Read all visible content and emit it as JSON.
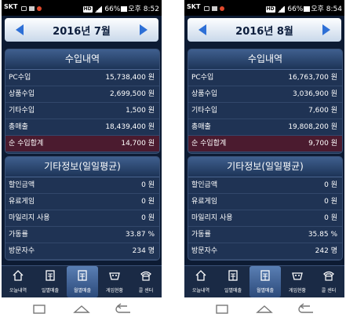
{
  "status_bar": {
    "carrier": "SKT",
    "hd_badge": "HD",
    "battery": "66%"
  },
  "phones": [
    {
      "time": "오후 8:52",
      "month_label": "2016년 7월",
      "income": {
        "title": "수입내역",
        "rows": [
          {
            "label": "PC수입",
            "value": "15,738,400 원"
          },
          {
            "label": "상품수입",
            "value": "2,699,500 원"
          },
          {
            "label": "기타수입",
            "value": "1,500 원"
          },
          {
            "label": "총매출",
            "value": "18,439,400 원"
          },
          {
            "label": "순 수입합계",
            "value": "14,700 원"
          }
        ]
      },
      "other": {
        "title": "기타정보(일일평균)",
        "rows": [
          {
            "label": "할인금액",
            "value": "0 원"
          },
          {
            "label": "유료게임",
            "value": "0 원"
          },
          {
            "label": "마일리지 사용",
            "value": "0 원"
          },
          {
            "label": "가동률",
            "value": "33.87 %"
          },
          {
            "label": "방문자수",
            "value": "234 명"
          }
        ]
      }
    },
    {
      "time": "오후 8:54",
      "month_label": "2016년 8월",
      "income": {
        "title": "수입내역",
        "rows": [
          {
            "label": "PC수입",
            "value": "16,763,700 원"
          },
          {
            "label": "상품수입",
            "value": "3,036,900 원"
          },
          {
            "label": "기타수입",
            "value": "7,600 원"
          },
          {
            "label": "총매출",
            "value": "19,808,200 원"
          },
          {
            "label": "순 수입합계",
            "value": "9,700 원"
          }
        ]
      },
      "other": {
        "title": "기타정보(일일평균)",
        "rows": [
          {
            "label": "할인금액",
            "value": "0 원"
          },
          {
            "label": "유료게임",
            "value": "0 원"
          },
          {
            "label": "마일리지 사용",
            "value": "0 원"
          },
          {
            "label": "가동률",
            "value": "35.85 %"
          },
          {
            "label": "방문자수",
            "value": "242 명"
          }
        ]
      }
    }
  ],
  "bottom_nav": [
    {
      "label": "오늘내역",
      "icon": "home-icon"
    },
    {
      "label": "일별매출",
      "icon": "daily-sales-icon"
    },
    {
      "label": "월별매출",
      "icon": "monthly-sales-icon",
      "active": true
    },
    {
      "label": "게임현황",
      "icon": "gamepad-icon"
    },
    {
      "label": "콜 센터",
      "icon": "phone-icon"
    }
  ],
  "system_nav": [
    "recent-apps-icon",
    "home-button-icon",
    "back-icon"
  ],
  "colors": {
    "background": "#0d1b33",
    "section": "#1f3354",
    "net_row": "#4b1b2f",
    "accent_arrow": "#2d6fd6"
  }
}
